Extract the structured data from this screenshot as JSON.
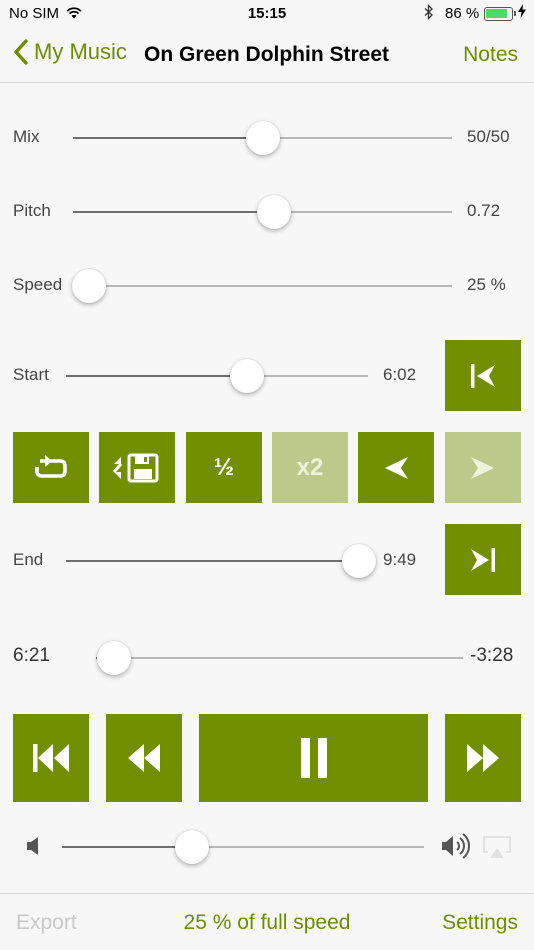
{
  "status_bar": {
    "carrier": "No SIM",
    "time": "15:15",
    "battery": "86 %",
    "battery_level": 0.86,
    "icons": [
      "wifi-icon",
      "bluetooth-icon",
      "battery-icon",
      "charging-icon"
    ]
  },
  "nav": {
    "back_label": "My Music",
    "title": "On Green Dolphin Street",
    "notes_label": "Notes"
  },
  "sliders": {
    "mix": {
      "label": "Mix",
      "value": "50/50",
      "position": 0.5
    },
    "pitch": {
      "label": "Pitch",
      "value": "0.72",
      "position": 0.53
    },
    "speed": {
      "label": "Speed",
      "value": "25 %",
      "position": 0.0
    }
  },
  "loop": {
    "start": {
      "label": "Start",
      "value": "6:02",
      "position": 0.6
    },
    "end": {
      "label": "End",
      "value": "9:49",
      "position": 0.97
    }
  },
  "loop_buttons": [
    {
      "name": "loop-toggle-button",
      "icon": "loop-icon"
    },
    {
      "name": "save-loop-button",
      "icon": "save-loop-icon"
    },
    {
      "name": "half-loop-button",
      "text": "½"
    },
    {
      "name": "double-loop-button",
      "text": "x2",
      "disabled": true
    },
    {
      "name": "shift-loop-back-button",
      "icon": "chevron-left-icon"
    },
    {
      "name": "shift-loop-forward-button",
      "icon": "chevron-right-icon",
      "disabled": true
    }
  ],
  "position": {
    "elapsed": "6:21",
    "remaining": "-3:28",
    "progress": 0.05
  },
  "transport": {
    "icons": [
      "skip-back-icon",
      "rewind-icon",
      "pause-icon",
      "fast-forward-icon"
    ]
  },
  "volume": {
    "level": 0.36
  },
  "toolbar": {
    "export_label": "Export",
    "speed_info": "25 % of full speed",
    "settings_label": "Settings"
  },
  "colors": {
    "accent": "#718f00",
    "accent_disabled": "#bcc98a",
    "text_accent": "#6b8e00",
    "background": "#f7f7f7"
  }
}
